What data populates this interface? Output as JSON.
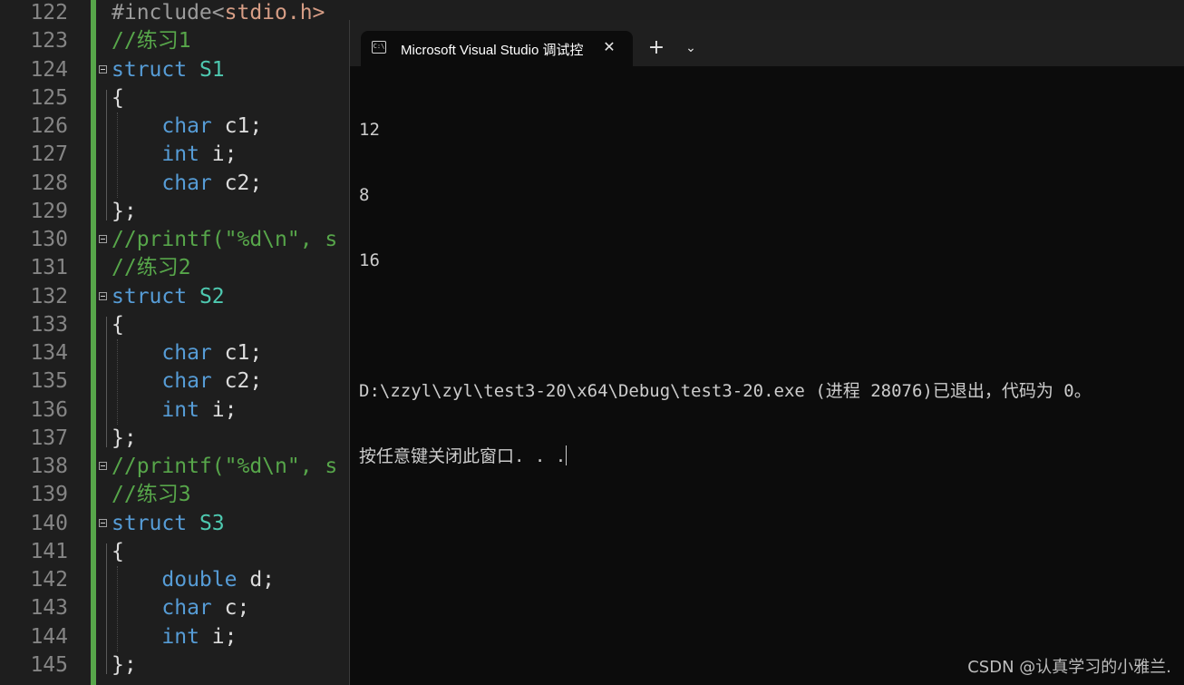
{
  "editor": {
    "lines": [
      {
        "num": "122",
        "parts": [
          {
            "t": "#include<",
            "c": "pp"
          },
          {
            "t": "stdio.h>",
            "c": "str"
          }
        ]
      },
      {
        "num": "123",
        "parts": [
          {
            "t": "//练习1",
            "c": "cm"
          }
        ]
      },
      {
        "num": "124",
        "fold": true,
        "parts": [
          {
            "t": "struct ",
            "c": "kw"
          },
          {
            "t": "S1",
            "c": "ty"
          }
        ]
      },
      {
        "num": "125",
        "parts": [
          {
            "t": "{",
            "c": ""
          }
        ]
      },
      {
        "num": "126",
        "parts": [
          {
            "t": "    ",
            "c": ""
          },
          {
            "t": "char",
            "c": "kw"
          },
          {
            "t": " c1;",
            "c": ""
          }
        ]
      },
      {
        "num": "127",
        "parts": [
          {
            "t": "    ",
            "c": ""
          },
          {
            "t": "int",
            "c": "kw"
          },
          {
            "t": " i;",
            "c": ""
          }
        ]
      },
      {
        "num": "128",
        "parts": [
          {
            "t": "    ",
            "c": ""
          },
          {
            "t": "char",
            "c": "kw"
          },
          {
            "t": " c2;",
            "c": ""
          }
        ]
      },
      {
        "num": "129",
        "parts": [
          {
            "t": "};",
            "c": ""
          }
        ]
      },
      {
        "num": "130",
        "fold": true,
        "parts": [
          {
            "t": "//printf(\"%d\\n\", s",
            "c": "cm"
          }
        ]
      },
      {
        "num": "131",
        "parts": [
          {
            "t": "//练习2",
            "c": "cm"
          }
        ]
      },
      {
        "num": "132",
        "fold": true,
        "parts": [
          {
            "t": "struct ",
            "c": "kw"
          },
          {
            "t": "S2",
            "c": "ty"
          }
        ]
      },
      {
        "num": "133",
        "parts": [
          {
            "t": "{",
            "c": ""
          }
        ]
      },
      {
        "num": "134",
        "parts": [
          {
            "t": "    ",
            "c": ""
          },
          {
            "t": "char",
            "c": "kw"
          },
          {
            "t": " c1;",
            "c": ""
          }
        ]
      },
      {
        "num": "135",
        "parts": [
          {
            "t": "    ",
            "c": ""
          },
          {
            "t": "char",
            "c": "kw"
          },
          {
            "t": " c2;",
            "c": ""
          }
        ]
      },
      {
        "num": "136",
        "parts": [
          {
            "t": "    ",
            "c": ""
          },
          {
            "t": "int",
            "c": "kw"
          },
          {
            "t": " i;",
            "c": ""
          }
        ]
      },
      {
        "num": "137",
        "parts": [
          {
            "t": "};",
            "c": ""
          }
        ]
      },
      {
        "num": "138",
        "fold": true,
        "parts": [
          {
            "t": "//printf(\"%d\\n\", s",
            "c": "cm"
          }
        ]
      },
      {
        "num": "139",
        "parts": [
          {
            "t": "//练习3",
            "c": "cm"
          }
        ]
      },
      {
        "num": "140",
        "fold": true,
        "parts": [
          {
            "t": "struct ",
            "c": "kw"
          },
          {
            "t": "S3",
            "c": "ty"
          }
        ]
      },
      {
        "num": "141",
        "parts": [
          {
            "t": "{",
            "c": ""
          }
        ]
      },
      {
        "num": "142",
        "parts": [
          {
            "t": "    ",
            "c": ""
          },
          {
            "t": "double",
            "c": "kw"
          },
          {
            "t": " d;",
            "c": ""
          }
        ]
      },
      {
        "num": "143",
        "parts": [
          {
            "t": "    ",
            "c": ""
          },
          {
            "t": "char",
            "c": "kw"
          },
          {
            "t": " c;",
            "c": ""
          }
        ]
      },
      {
        "num": "144",
        "parts": [
          {
            "t": "    ",
            "c": ""
          },
          {
            "t": "int",
            "c": "kw"
          },
          {
            "t": " i;",
            "c": ""
          }
        ]
      },
      {
        "num": "145",
        "parts": [
          {
            "t": "};",
            "c": ""
          }
        ]
      }
    ]
  },
  "terminal": {
    "tab_title": "Microsoft Visual Studio 调试控",
    "tab_icon_text": "C:\\",
    "close_glyph": "✕",
    "new_tab_glyph": "+",
    "dropdown_glyph": "⌄",
    "output": {
      "line1": "12",
      "line2": "8",
      "line3": "16",
      "line4": "",
      "line5": "D:\\zzyl\\zyl\\test3-20\\x64\\Debug\\test3-20.exe (进程 28076)已退出，代码为 0。",
      "line6": "按任意键关闭此窗口. . ."
    }
  },
  "watermark": "CSDN @认真学习的小雅兰."
}
